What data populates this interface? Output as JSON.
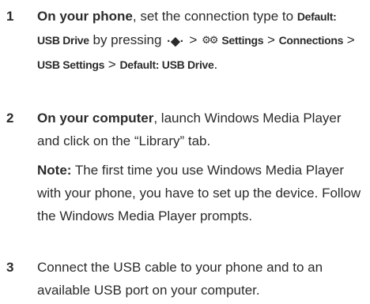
{
  "steps": [
    {
      "number": "1",
      "lead": "On your phone",
      "text_a": ", set the connection type to ",
      "menu_default_line1": "Default:",
      "menu_default_line2": "USB Drive",
      "text_b": " by pressing ",
      "nav_key_glyph": "·◆·",
      "gt1": " > ",
      "settings_icon_glyph": "⚙⚙",
      "menu_settings": "Settings",
      "gt2": " > ",
      "menu_connections": "Connections",
      "gt3": " > ",
      "menu_usb_settings": "USB Settings",
      "gt4": " > ",
      "menu_default_usb": "Default: USB Drive",
      "end": "."
    },
    {
      "number": "2",
      "lead": "On your computer",
      "text": ", launch Windows Media Player and click on the “Library” tab."
    },
    {
      "number": "3",
      "text": "Connect the USB cable to your phone and to an available USB port on your computer."
    }
  ],
  "note": {
    "label": "Note:",
    "text": " The first time you use Windows Media Player with your phone, you have to set up the device. Follow the Windows Media Player prompts."
  },
  "icons": {
    "nav_key": "nav-key-icon",
    "settings": "settings-icon"
  }
}
